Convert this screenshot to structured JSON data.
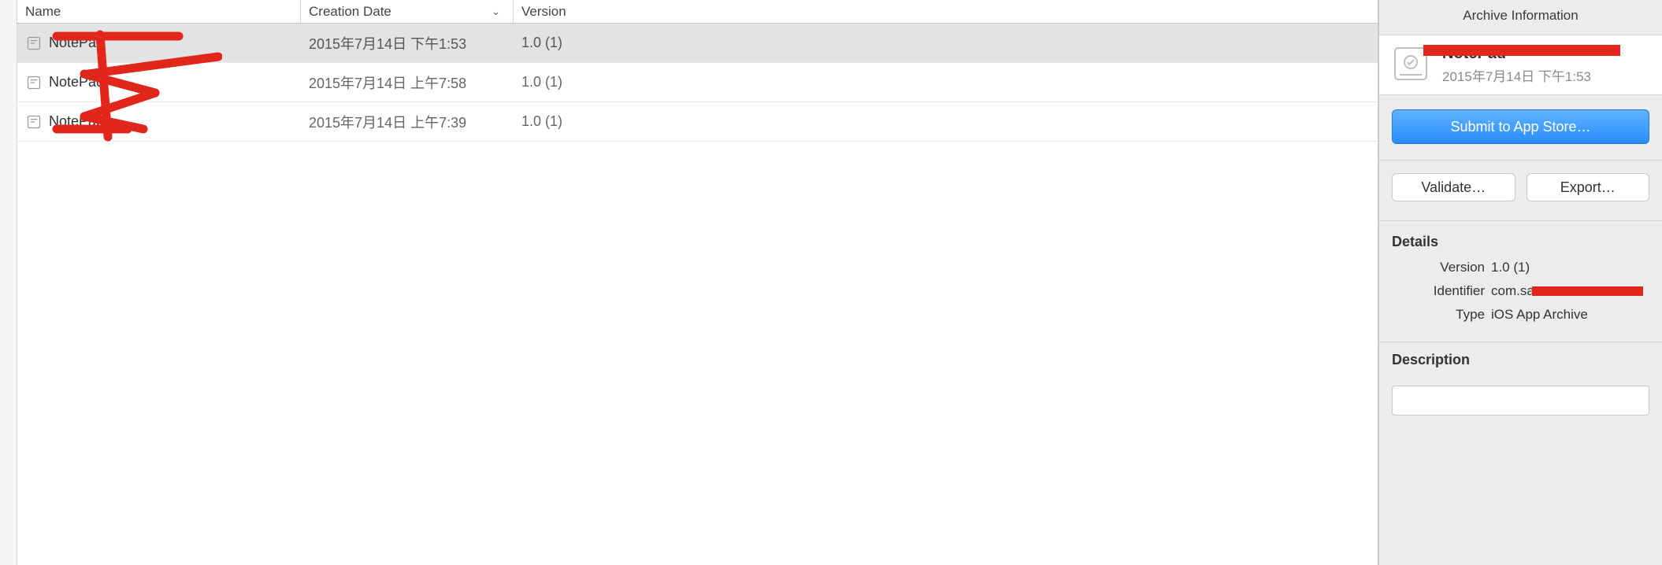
{
  "columns": {
    "name": "Name",
    "date": "Creation Date",
    "version": "Version"
  },
  "rows": [
    {
      "name": "NotePad",
      "date": "2015年7月14日 下午1:53",
      "version": "1.0 (1)",
      "selected": true
    },
    {
      "name": "NotePad",
      "date": "2015年7月14日 上午7:58",
      "version": "1.0 (1)",
      "selected": false
    },
    {
      "name": "NotePad",
      "date": "2015年7月14日 上午7:39",
      "version": "1.0 (1)",
      "selected": false
    }
  ],
  "panel": {
    "title": "Archive Information",
    "archive_name": "NotePad",
    "archive_date": "2015年7月14日 下午1:53",
    "submit_label": "Submit to App Store…",
    "validate_label": "Validate…",
    "export_label": "Export…",
    "details_heading": "Details",
    "details": {
      "version_key": "Version",
      "version_val": "1.0 (1)",
      "identifier_key": "Identifier",
      "identifier_val": "com.sa",
      "type_key": "Type",
      "type_val": "iOS App Archive"
    },
    "description_heading": "Description",
    "description_value": ""
  }
}
